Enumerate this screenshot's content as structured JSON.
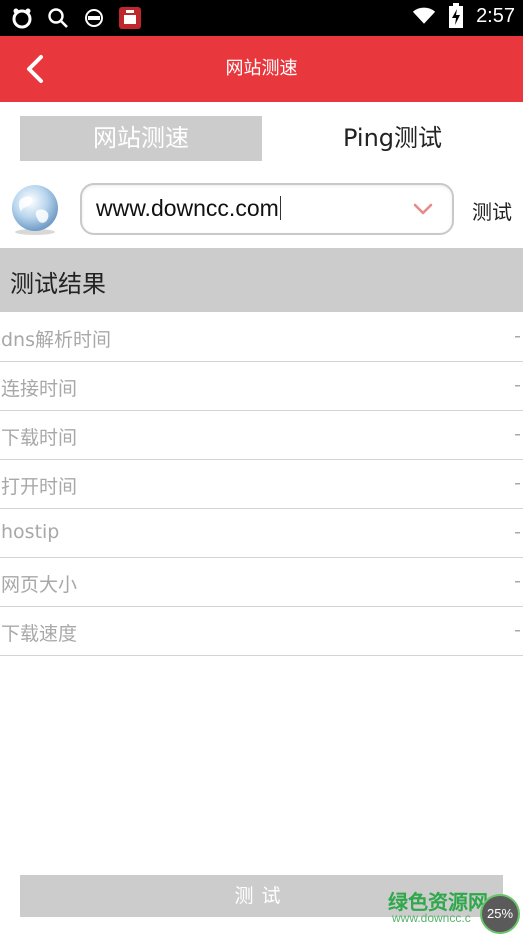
{
  "status_bar": {
    "time": "2:57",
    "left_icons": [
      "ring-icon",
      "search-icon",
      "face-mask-icon",
      "app-badge-icon"
    ],
    "right_icons": [
      "wifi-icon",
      "battery-charging-icon"
    ]
  },
  "header": {
    "title": "网站测速",
    "back_icon": "chevron-left-icon",
    "color": "#e8383d"
  },
  "tabs": [
    {
      "label": "网站测速",
      "active": true
    },
    {
      "label": "Ping测试",
      "active": false
    }
  ],
  "url_input": {
    "value": "www.downcc.com",
    "dropdown_icon": "chevron-down-icon",
    "test_label": "测试"
  },
  "results": {
    "title": "测试结果",
    "rows": [
      {
        "label": "dns解析时间",
        "value": "-"
      },
      {
        "label": "连接时间",
        "value": "-"
      },
      {
        "label": "下载时间",
        "value": "-"
      },
      {
        "label": "打开时间",
        "value": "-"
      },
      {
        "label": "hostip",
        "value": "-"
      },
      {
        "label": "网页大小",
        "value": "-"
      },
      {
        "label": "下载速度",
        "value": "-"
      }
    ]
  },
  "bottom_button": {
    "label": "测试"
  },
  "watermark": {
    "text": "绿色资源网",
    "url": "www.downcc.c",
    "badge": "25%"
  }
}
